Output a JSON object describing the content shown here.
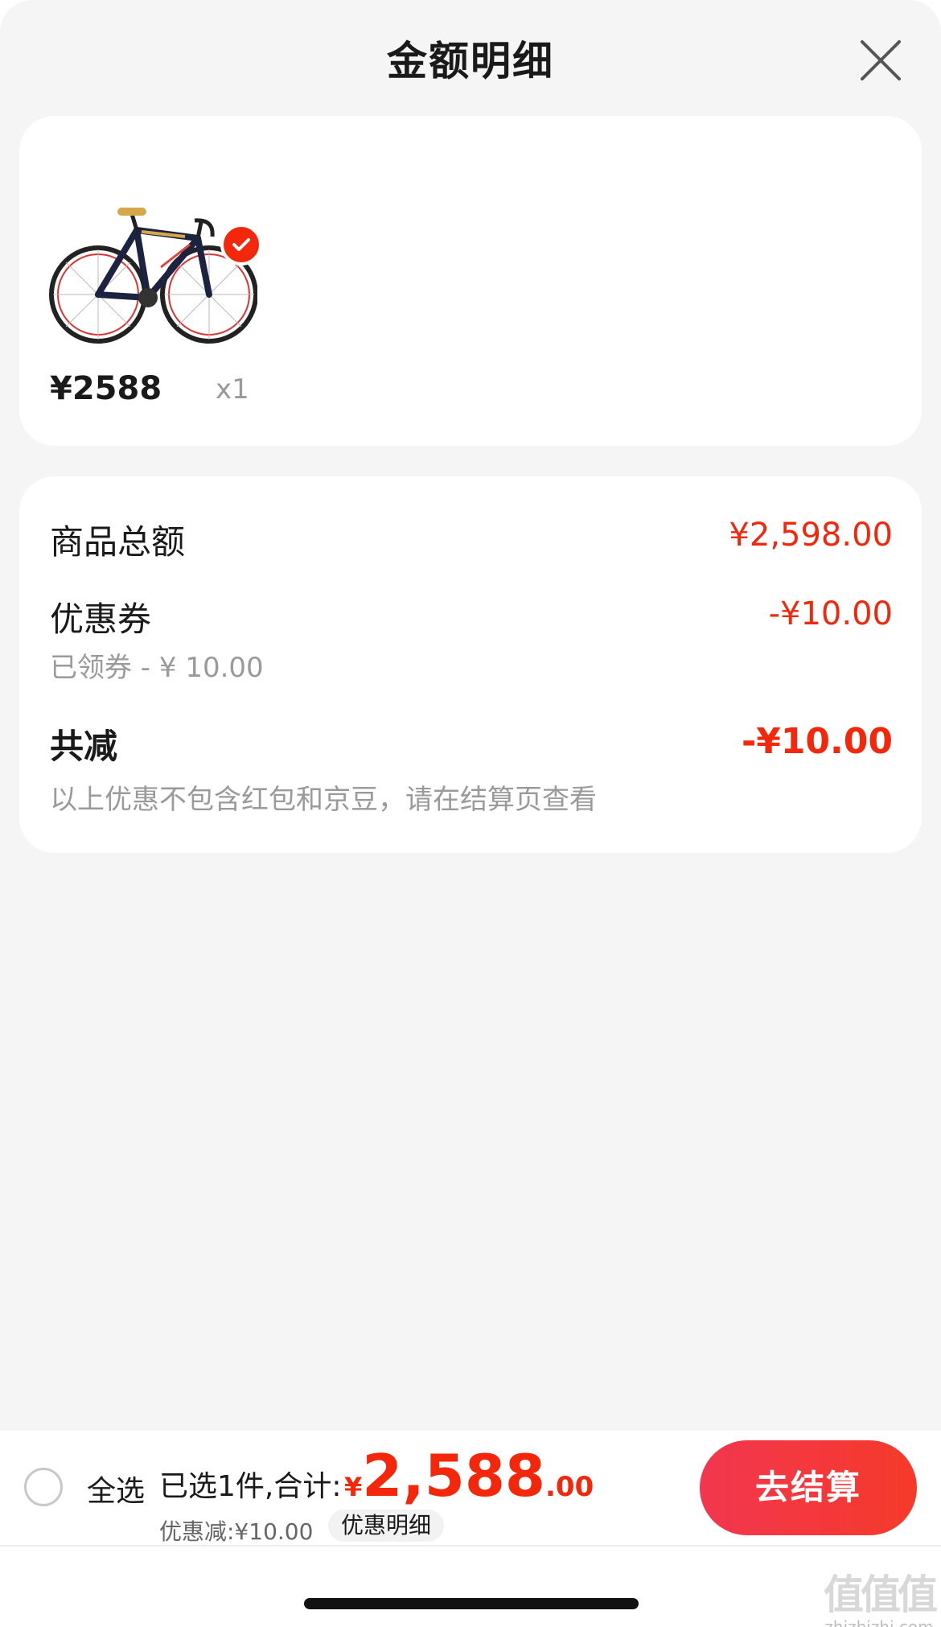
{
  "header": {
    "title": "金额明细"
  },
  "product": {
    "price": "¥2588",
    "quantity": "x1"
  },
  "summary": {
    "goods_total_label": "商品总额",
    "goods_total_value": "¥2,598.00",
    "coupon_label": "优惠券",
    "coupon_value": "-¥10.00",
    "coupon_sub": "已领券 - ¥ 10.00",
    "total_reduce_label": "共减",
    "total_reduce_value": "-¥10.00",
    "note": "以上优惠不包含红包和京豆，请在结算页查看"
  },
  "bottom_bar": {
    "select_all": "全选",
    "selected_text": "已选1件,合计:",
    "currency": "¥",
    "total_int": "2,588",
    "total_dec": ".00",
    "discount_text": "优惠减:¥10.00",
    "discount_detail": "优惠明细",
    "checkout": "去结算"
  },
  "watermark": {
    "glyphs": "值值值",
    "domain": "zhizhizhi.com"
  },
  "colors": {
    "accent": "#f2270c",
    "background": "#f5f5f5"
  }
}
